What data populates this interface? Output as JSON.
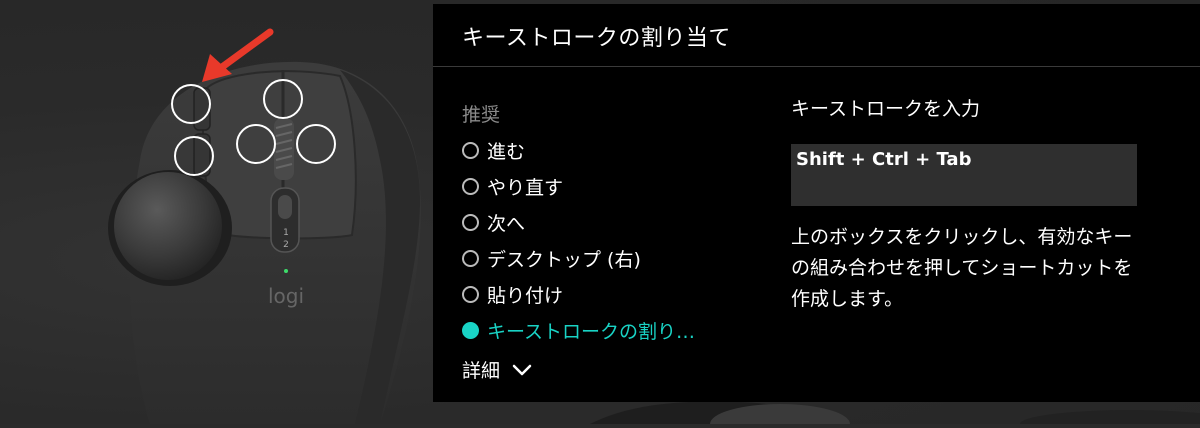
{
  "panel": {
    "title": "キーストロークの割り当て",
    "group_label": "推奨",
    "options": [
      {
        "label": "進む",
        "selected": false
      },
      {
        "label": "やり直す",
        "selected": false
      },
      {
        "label": "次へ",
        "selected": false
      },
      {
        "label": "デスクトップ (右)",
        "selected": false
      },
      {
        "label": "貼り付け",
        "selected": false
      },
      {
        "label": "キーストロークの割り…",
        "selected": true
      }
    ],
    "details_label": "詳細",
    "input_label": "キーストロークを入力",
    "keystroke_value": "Shift + Ctrl + Tab",
    "help_text": "上のボックスをクリックし、有効なキーの組み合わせを押してショートカットを作成します。"
  },
  "mouse": {
    "logo": "logi",
    "button_labels": [
      "1",
      "2"
    ]
  },
  "colors": {
    "accent": "#19d3c5",
    "arrow": "#e8392a",
    "panel_bg": "#000000",
    "input_bg": "#2f2f2f"
  }
}
